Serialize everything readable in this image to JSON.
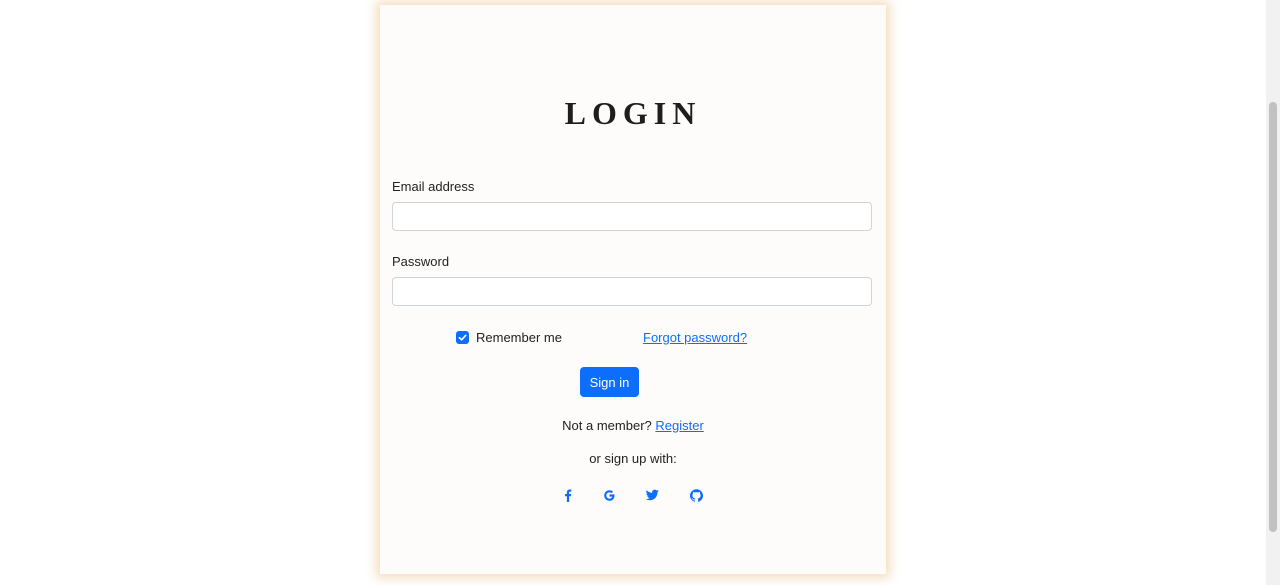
{
  "login": {
    "title": "LOGIN",
    "email_label": "Email address",
    "email_value": "",
    "password_label": "Password",
    "password_value": "",
    "remember_label": "Remember me",
    "remember_checked": true,
    "forgot_label": "Forgot password?",
    "signin_label": "Sign in",
    "not_member_text": "Not a member?",
    "register_label": "Register",
    "signup_with_text": "or sign up with:"
  },
  "social": [
    {
      "icon": "facebook-icon"
    },
    {
      "icon": "google-icon"
    },
    {
      "icon": "twitter-icon"
    },
    {
      "icon": "github-icon"
    }
  ],
  "colors": {
    "accent": "#0d6efd",
    "card_background": "#fefcfa",
    "card_glow": "#f0d2aa",
    "title": "#1e1e1e"
  }
}
